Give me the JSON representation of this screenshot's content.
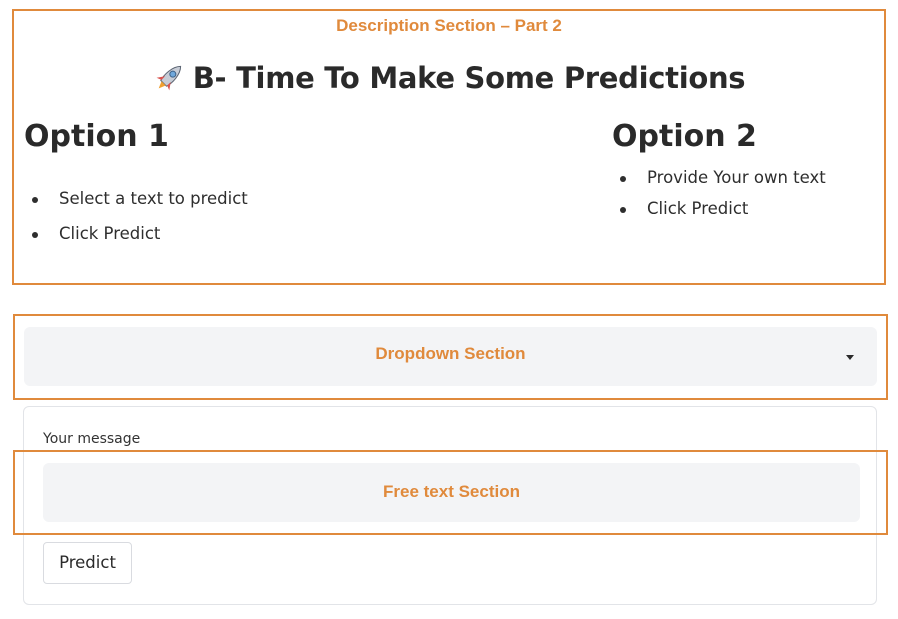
{
  "description_section": {
    "annotation_label": "Description Section – Part 2",
    "heading_icon": "rocket-icon",
    "heading": "B- Time To Make Some Predictions",
    "option1": {
      "title": "Option 1",
      "items": [
        "Select a text to predict",
        "Click Predict"
      ]
    },
    "option2": {
      "title": "Option 2",
      "items": [
        "Provide Your own text",
        "Click Predict"
      ]
    }
  },
  "dropdown_section": {
    "annotation_label": "Dropdown Section",
    "icon": "caret-down-icon"
  },
  "message": {
    "label": "Your message",
    "annotation_label": "Free text Section",
    "predict_label": "Predict"
  },
  "colors": {
    "annotation_orange": "#e08a3c",
    "field_background": "#f3f4f6",
    "text_dark": "#2a2a2a"
  }
}
